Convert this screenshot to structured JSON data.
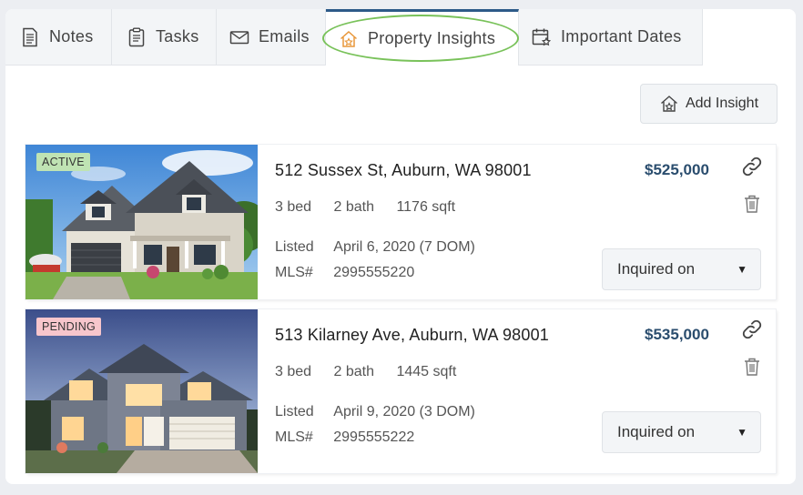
{
  "tabs": [
    {
      "label": "Notes",
      "icon": "notes-icon"
    },
    {
      "label": "Tasks",
      "icon": "tasks-icon"
    },
    {
      "label": "Emails",
      "icon": "email-icon"
    },
    {
      "label": "Property Insights",
      "icon": "house-star-icon",
      "active": true
    },
    {
      "label": "Important Dates",
      "icon": "calendar-star-icon"
    }
  ],
  "toolbar": {
    "add_insight_label": "Add Insight"
  },
  "colors": {
    "accent": "#2a4d6e",
    "active_tab_border": "#2d5a88",
    "highlight": "#79c25a",
    "active_badge": "#bfe3b3",
    "pending_badge": "#f7c6cc"
  },
  "properties": [
    {
      "status": "ACTIVE",
      "address": "512 Sussex St, Auburn, WA 98001",
      "price": "$525,000",
      "beds": "3 bed",
      "baths": "2 bath",
      "sqft": "1176 sqft",
      "listed_label": "Listed",
      "listed_value": "April 6, 2020 (7 DOM)",
      "mls_label": "MLS#",
      "mls_value": "2995555220",
      "select_value": "Inquired on"
    },
    {
      "status": "PENDING",
      "address": "513 Kilarney Ave, Auburn, WA 98001",
      "price": "$535,000",
      "beds": "3 bed",
      "baths": "2 bath",
      "sqft": "1445 sqft",
      "listed_label": "Listed",
      "listed_value": "April 9, 2020 (3 DOM)",
      "mls_label": "MLS#",
      "mls_value": "2995555222",
      "select_value": "Inquired on"
    }
  ]
}
